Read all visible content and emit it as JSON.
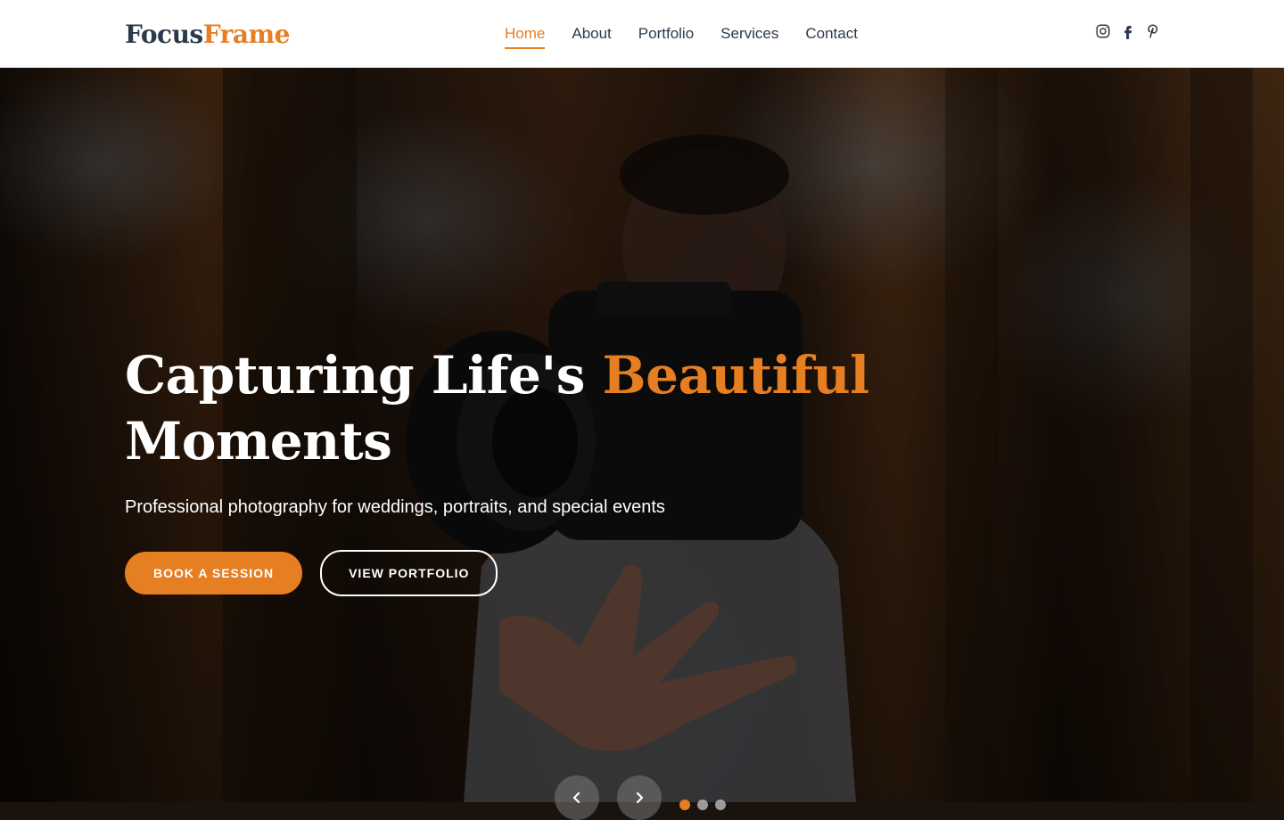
{
  "brand": {
    "name_part1": "Focus",
    "name_part2": "Frame",
    "accent_color": "#e67e22",
    "text_color": "#2b3a4a"
  },
  "nav": {
    "items": [
      {
        "label": "Home",
        "active": true
      },
      {
        "label": "About",
        "active": false
      },
      {
        "label": "Portfolio",
        "active": false
      },
      {
        "label": "Services",
        "active": false
      },
      {
        "label": "Contact",
        "active": false
      }
    ]
  },
  "social": {
    "icons": [
      "instagram-icon",
      "facebook-icon",
      "pinterest-icon"
    ]
  },
  "hero": {
    "title_part1": "Capturing Life's ",
    "title_accent": "Beautiful",
    "title_part2": "Moments",
    "subtitle": "Professional photography for weddings, portraits, and special events",
    "primary_button": "Book a Session",
    "secondary_button": "View Portfolio"
  },
  "carousel": {
    "prev_icon": "chevron-left-icon",
    "next_icon": "chevron-right-icon",
    "dots": 3,
    "active_dot": 1
  }
}
